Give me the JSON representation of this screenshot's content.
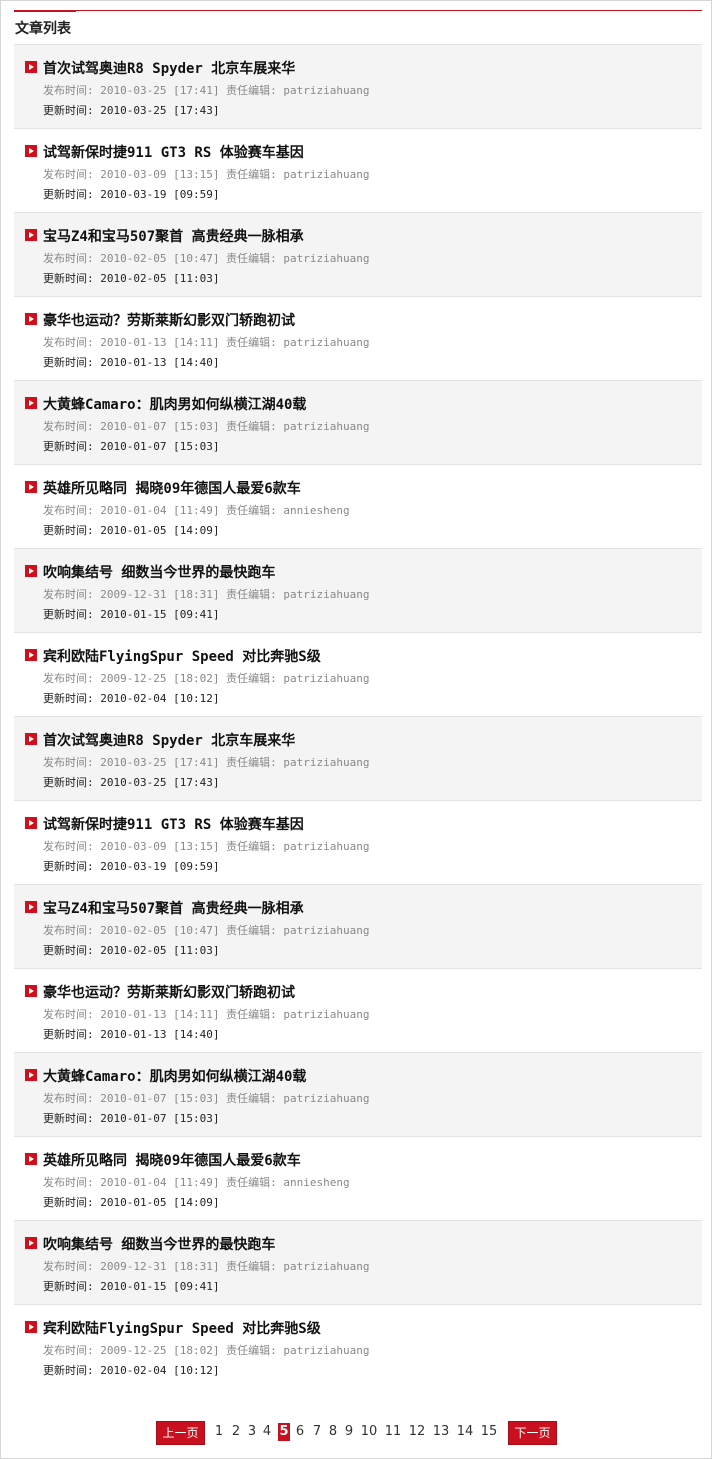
{
  "header": {
    "title": "文章列表"
  },
  "articles": [
    {
      "title": "首次试驾奥迪R8 Spyder 北京车展来华",
      "published_label": "发布时间:",
      "published": "2010-03-25 [17:41]",
      "editor_label": "责任编辑:",
      "editor": "patriziahuang",
      "updated_label": "更新时间:",
      "updated": "2010-03-25 [17:43]"
    },
    {
      "title": "试驾新保时捷911 GT3 RS 体验赛车基因",
      "published_label": "发布时间:",
      "published": "2010-03-09 [13:15]",
      "editor_label": "责任编辑:",
      "editor": "patriziahuang",
      "updated_label": "更新时间:",
      "updated": "2010-03-19 [09:59]"
    },
    {
      "title": "宝马Z4和宝马507聚首 高贵经典一脉相承",
      "published_label": "发布时间:",
      "published": "2010-02-05 [10:47]",
      "editor_label": "责任编辑:",
      "editor": "patriziahuang",
      "updated_label": "更新时间:",
      "updated": "2010-02-05 [11:03]"
    },
    {
      "title": "豪华也运动？劳斯莱斯幻影双门轿跑初试",
      "published_label": "发布时间:",
      "published": "2010-01-13 [14:11]",
      "editor_label": "责任编辑:",
      "editor": "patriziahuang",
      "updated_label": "更新时间:",
      "updated": "2010-01-13 [14:40]"
    },
    {
      "title": "大黄蜂Camaro：肌肉男如何纵横江湖40载",
      "published_label": "发布时间:",
      "published": "2010-01-07 [15:03]",
      "editor_label": "责任编辑:",
      "editor": "patriziahuang",
      "updated_label": "更新时间:",
      "updated": "2010-01-07 [15:03]"
    },
    {
      "title": "英雄所见略同 揭晓09年德国人最爱6款车",
      "published_label": "发布时间:",
      "published": "2010-01-04 [11:49]",
      "editor_label": "责任编辑:",
      "editor": "anniesheng",
      "updated_label": "更新时间:",
      "updated": "2010-01-05 [14:09]"
    },
    {
      "title": "吹响集结号 细数当今世界的最快跑车",
      "published_label": "发布时间:",
      "published": "2009-12-31 [18:31]",
      "editor_label": "责任编辑:",
      "editor": "patriziahuang",
      "updated_label": "更新时间:",
      "updated": "2010-01-15 [09:41]"
    },
    {
      "title": "宾利欧陆FlyingSpur Speed 对比奔驰S级",
      "published_label": "发布时间:",
      "published": "2009-12-25 [18:02]",
      "editor_label": "责任编辑:",
      "editor": "patriziahuang",
      "updated_label": "更新时间:",
      "updated": "2010-02-04 [10:12]"
    },
    {
      "title": "首次试驾奥迪R8 Spyder 北京车展来华",
      "published_label": "发布时间:",
      "published": "2010-03-25 [17:41]",
      "editor_label": "责任编辑:",
      "editor": "patriziahuang",
      "updated_label": "更新时间:",
      "updated": "2010-03-25 [17:43]"
    },
    {
      "title": "试驾新保时捷911 GT3 RS 体验赛车基因",
      "published_label": "发布时间:",
      "published": "2010-03-09 [13:15]",
      "editor_label": "责任编辑:",
      "editor": "patriziahuang",
      "updated_label": "更新时间:",
      "updated": "2010-03-19 [09:59]"
    },
    {
      "title": "宝马Z4和宝马507聚首 高贵经典一脉相承",
      "published_label": "发布时间:",
      "published": "2010-02-05 [10:47]",
      "editor_label": "责任编辑:",
      "editor": "patriziahuang",
      "updated_label": "更新时间:",
      "updated": "2010-02-05 [11:03]"
    },
    {
      "title": "豪华也运动？劳斯莱斯幻影双门轿跑初试",
      "published_label": "发布时间:",
      "published": "2010-01-13 [14:11]",
      "editor_label": "责任编辑:",
      "editor": "patriziahuang",
      "updated_label": "更新时间:",
      "updated": "2010-01-13 [14:40]"
    },
    {
      "title": "大黄蜂Camaro：肌肉男如何纵横江湖40载",
      "published_label": "发布时间:",
      "published": "2010-01-07 [15:03]",
      "editor_label": "责任编辑:",
      "editor": "patriziahuang",
      "updated_label": "更新时间:",
      "updated": "2010-01-07 [15:03]"
    },
    {
      "title": "英雄所见略同 揭晓09年德国人最爱6款车",
      "published_label": "发布时间:",
      "published": "2010-01-04 [11:49]",
      "editor_label": "责任编辑:",
      "editor": "anniesheng",
      "updated_label": "更新时间:",
      "updated": "2010-01-05 [14:09]"
    },
    {
      "title": "吹响集结号 细数当今世界的最快跑车",
      "published_label": "发布时间:",
      "published": "2009-12-31 [18:31]",
      "editor_label": "责任编辑:",
      "editor": "patriziahuang",
      "updated_label": "更新时间:",
      "updated": "2010-01-15 [09:41]"
    },
    {
      "title": "宾利欧陆FlyingSpur Speed 对比奔驰S级",
      "published_label": "发布时间:",
      "published": "2009-12-25 [18:02]",
      "editor_label": "责任编辑:",
      "editor": "patriziahuang",
      "updated_label": "更新时间:",
      "updated": "2010-02-04 [10:12]"
    }
  ],
  "pagination": {
    "prev_label": "上一页",
    "next_label": "下一页",
    "pages": [
      "1",
      "2",
      "3",
      "4",
      "5",
      "6",
      "7",
      "8",
      "9",
      "10",
      "11",
      "12",
      "13",
      "14",
      "15"
    ],
    "current": "5"
  },
  "colors": {
    "accent": "#c8101e",
    "row_shade": "#f4f4f4",
    "bullet_icon": "play-arrow-icon"
  }
}
